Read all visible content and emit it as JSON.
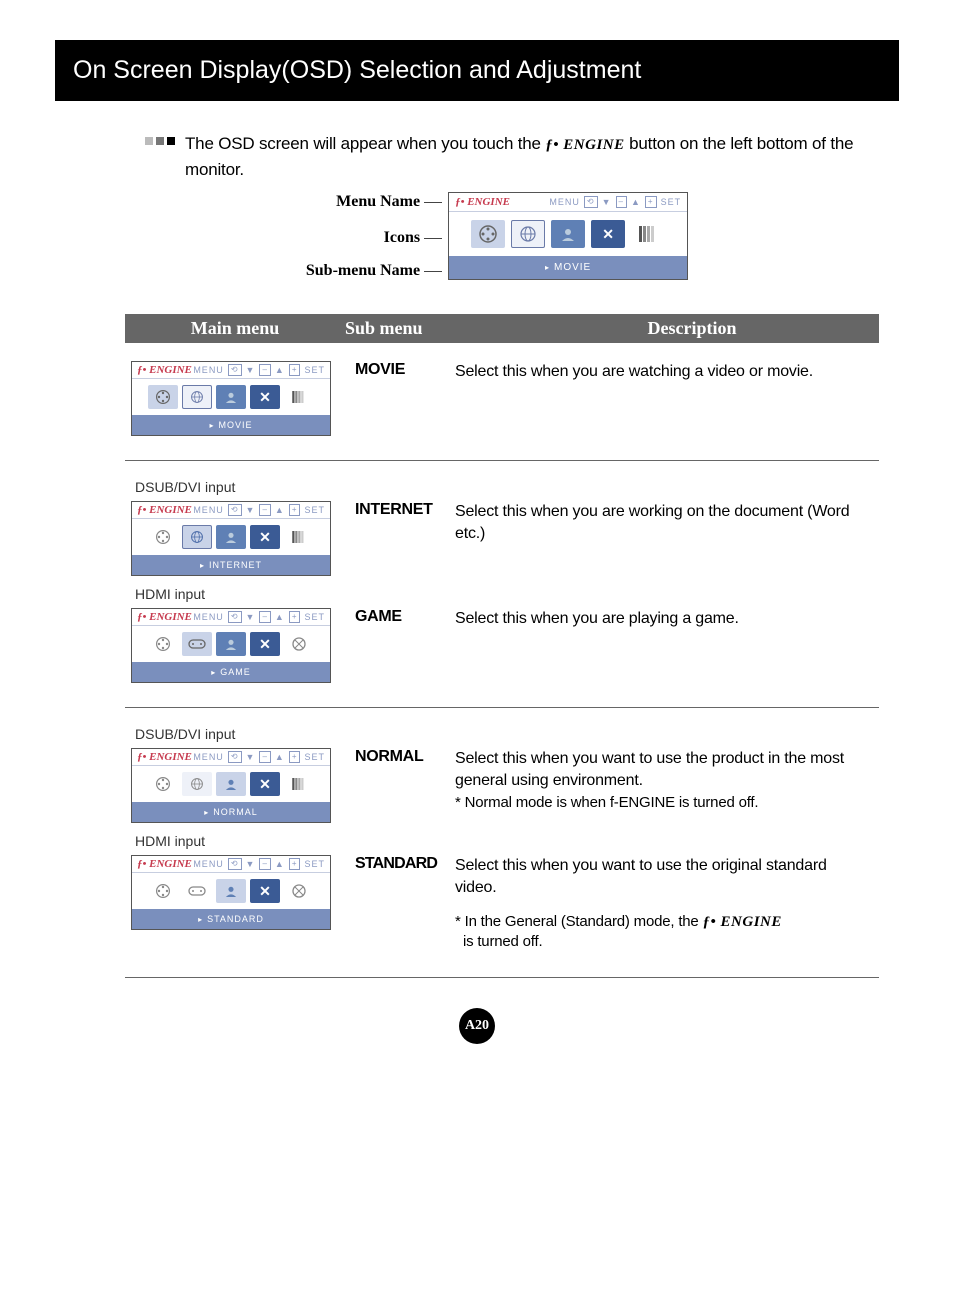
{
  "title": "On Screen Display(OSD) Selection and Adjustment",
  "intro": {
    "pre": "The OSD screen will appear when you touch the ",
    "button": "ƒ• ENGINE",
    "post": " button on the left bottom of the monitor."
  },
  "diagram": {
    "menu_name_label": "Menu Name",
    "icons_label": "Icons",
    "submenu_name_label": "Sub-menu Name",
    "osd_title": "ƒ• ENGINE",
    "osd_menu": "MENU",
    "osd_set": "SET",
    "osd_footer": "MOVIE"
  },
  "table_header": {
    "main": "Main menu",
    "sub": "Sub menu",
    "desc": "Description"
  },
  "rows": [
    {
      "input_above": "",
      "osd_footer": "MOVIE",
      "variant": "dsub",
      "submenu": "MOVIE",
      "description": "Select this when you are watching a video or movie.",
      "note": ""
    }
  ],
  "group2": {
    "dsub_label": "DSUB/DVI input",
    "hdmi_label": "HDMI input",
    "dsub_osd_footer": "INTERNET",
    "hdmi_osd_footer": "GAME",
    "internet": {
      "submenu": "INTERNET",
      "description": "Select this when you are working on the document (Word etc.)"
    },
    "game": {
      "submenu": "GAME",
      "description": "Select this when you are playing a game."
    }
  },
  "group3": {
    "dsub_label": "DSUB/DVI input",
    "hdmi_label": "HDMI input",
    "dsub_osd_footer": "NORMAL",
    "hdmi_osd_footer": "STANDARD",
    "normal": {
      "submenu": "NORMAL",
      "description": "Select this when you want to use the product in the most general using environment.",
      "note": "* Normal mode is when f-ENGINE is turned off."
    },
    "standard": {
      "submenu": "STANDARD",
      "description": "Select this when you want to use the original standard video.",
      "note_pre": "* In the General (Standard) mode, the  ",
      "note_engine": "ƒ• ENGINE",
      "note_post": "is turned off."
    }
  },
  "page_number": "A20"
}
